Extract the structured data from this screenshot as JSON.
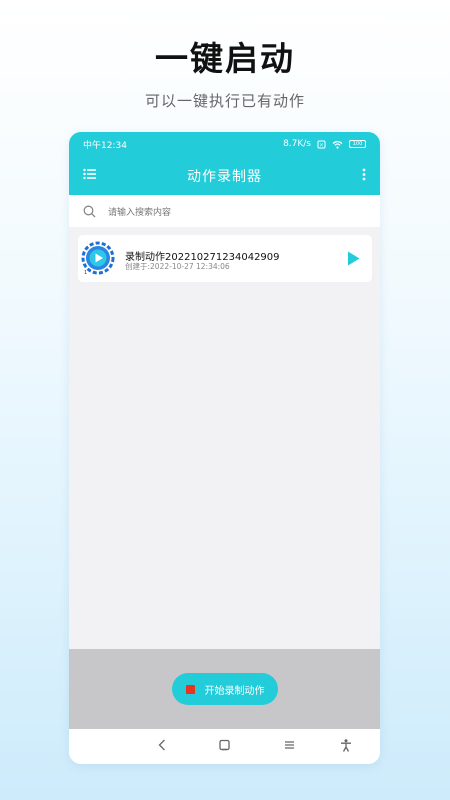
{
  "promo": {
    "headline": "一键启动",
    "subline": "可以一键执行已有动作"
  },
  "status_bar": {
    "time": "中午12:34",
    "speed": "8.7K/s",
    "battery": "100"
  },
  "app_bar": {
    "title": "动作录制器",
    "menu_icon": "menu-icon",
    "more_icon": "more-vertical-icon"
  },
  "search": {
    "placeholder": "请输入搜索内容",
    "icon": "search-icon"
  },
  "recordings": [
    {
      "title": "录制动作20221027123404290​9",
      "time": "创建于:2022-10-27 12:34:06"
    }
  ],
  "bottom": {
    "record_label": "开始录制动作"
  },
  "colors": {
    "accent": "#23ccd9",
    "record_red": "#e8331e",
    "bottom_panel": "#c7c7c9"
  }
}
